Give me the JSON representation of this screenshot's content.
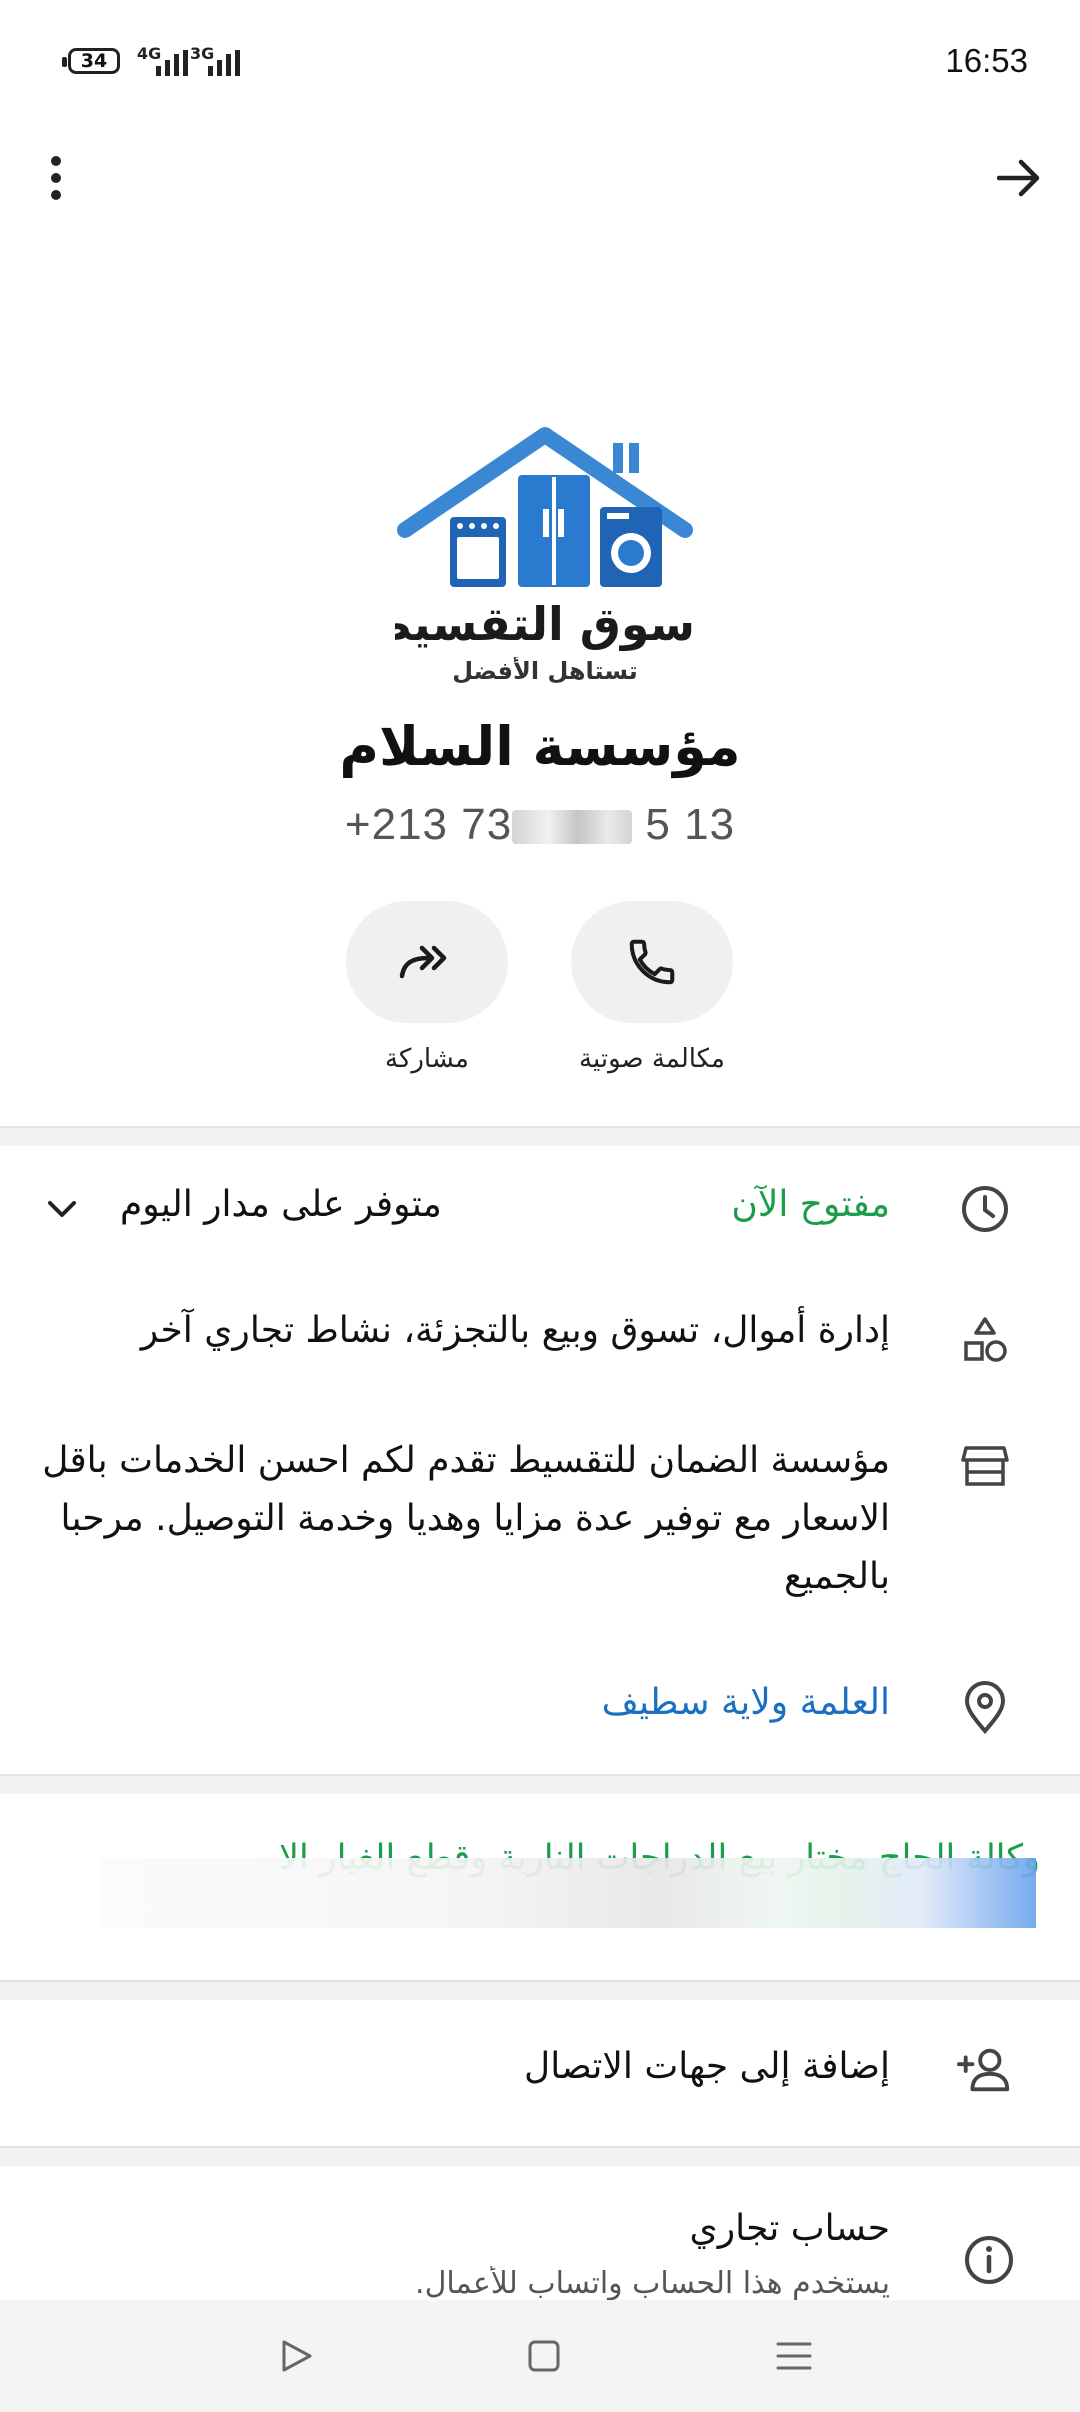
{
  "status_bar": {
    "battery": "34",
    "network_1": "4G",
    "network_2": "3G",
    "time": "16:53"
  },
  "header": {
    "menu_icon": "more-vert-icon",
    "back_icon": "arrow-forward-icon"
  },
  "profile": {
    "logo_line1": "سوق التقسيط",
    "logo_line2": "تستاهل الأفضل",
    "name": "مؤسسة السلام",
    "phone_start": "+213 ",
    "phone_end": "73",
    "phone_tail": " 5 13"
  },
  "actions": [
    {
      "label": "مكالمة صوتية",
      "icon": "phone-icon"
    },
    {
      "label": "مشاركة",
      "icon": "forward-icon"
    }
  ],
  "business_info": {
    "hours_status": "مفتوح الآن",
    "hours_detail": "متوفر على مدار اليوم",
    "category": "إدارة أموال، تسوق وبيع بالتجزئة، نشاط تجاري آخر",
    "description": "مؤسسة الضمان للتقسيط تقدم لكم احسن الخدمات باقل الاسعار مع توفير عدة مزايا وهديا وخدمة التوصيل. مرحبا بالجميع",
    "location": "العلمة ولاية سطيف"
  },
  "catalog": {
    "preview_text": "وكالة الحاج مختار بيع الدراجات النارية وقطع الغيار الا"
  },
  "add_contact": {
    "label": "إضافة إلى جهات الاتصال"
  },
  "business_account": {
    "title": "حساب تجاري",
    "subtitle": "يستخدم هذا الحساب واتساب للأعمال."
  },
  "colors": {
    "open_green": "#1a9e4a",
    "link_blue": "#1a6fc2",
    "logo_blue": "#2e7fd0"
  }
}
